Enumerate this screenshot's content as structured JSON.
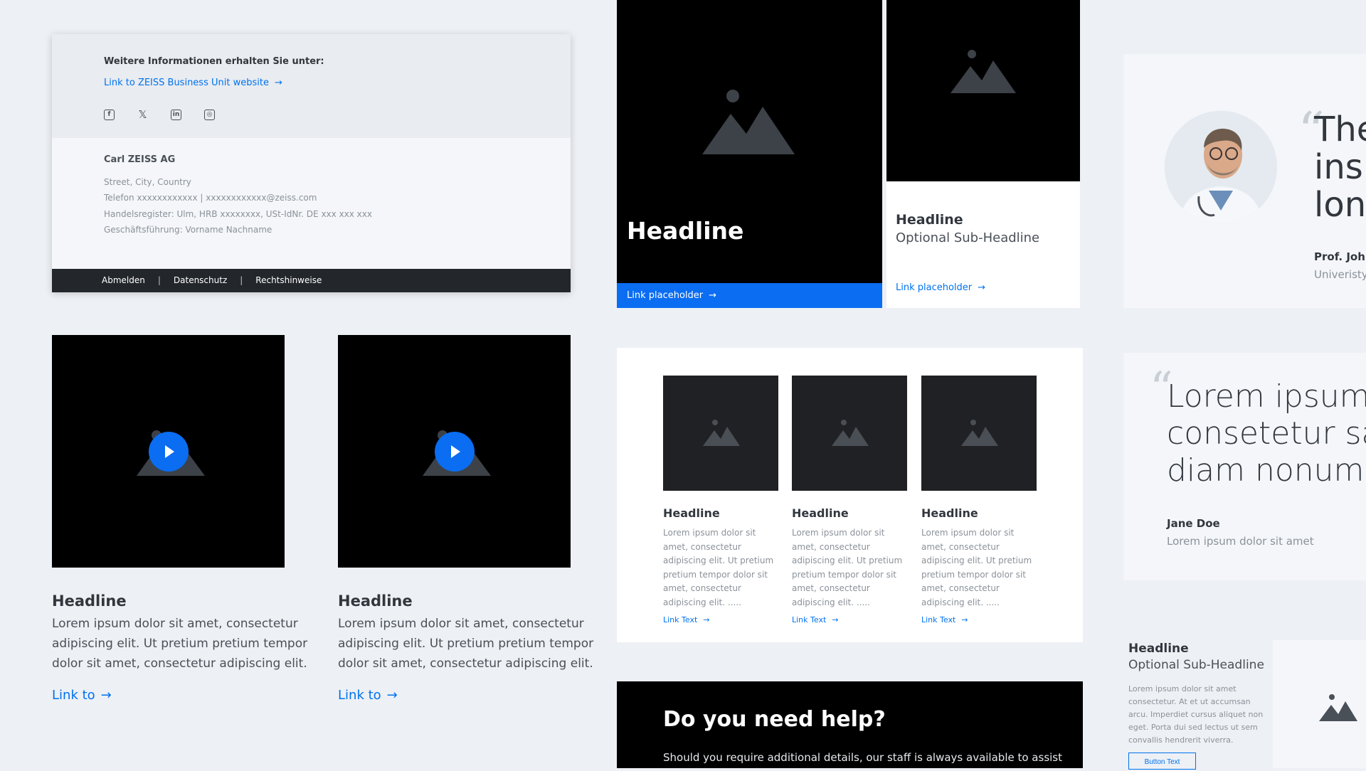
{
  "footer": {
    "info_label": "Weitere Informationen erhalten Sie unter:",
    "bu_link": "Link to ZEISS Business Unit website",
    "arrow": "→",
    "socials": [
      "facebook-icon",
      "x-icon",
      "linkedin-icon",
      "instagram-icon"
    ],
    "company": "Carl ZEISS AG",
    "address": "Street, City, Country",
    "contact": "Telefon xxxxxxxxxxxx |  xxxxxxxxxxxx@zeiss.com",
    "register": "Handelsregister: Ulm, HRB xxxxxxxx, USt-IdNr. DE xxx xxx xxx",
    "management": "Geschäftsführung: Vorname Nachname",
    "bar_links": [
      "Abmelden",
      "Datenschutz",
      "Rechtshinweise"
    ],
    "separator": "|"
  },
  "videos": [
    {
      "headline": "Headline",
      "text": "Lorem ipsum dolor sit amet, consectetur adipiscing elit. Ut pretium pretium tempor dolor sit amet, consectetur adipiscing elit.",
      "link": "Link to"
    },
    {
      "headline": "Headline",
      "text": "Lorem ipsum dolor sit amet, consectetur adipiscing elit. Ut pretium pretium tempor dolor sit amet, consectetur adipiscing elit.",
      "link": "Link to"
    }
  ],
  "hero": {
    "headline": "Headline",
    "link": "Link placeholder"
  },
  "card": {
    "headline": "Headline",
    "subheadline": "Optional Sub-Headline",
    "link": "Link placeholder"
  },
  "teasers": [
    {
      "headline": "Headline",
      "text": "Lorem ipsum dolor sit amet, consectetur adipiscing elit. Ut pretium pretium tempor dolor sit amet, consectetur adipiscing elit. .....",
      "link": "Link Text"
    },
    {
      "headline": "Headline",
      "text": "Lorem ipsum dolor sit amet, consectetur adipiscing elit. Ut pretium pretium tempor dolor sit amet, consectetur adipiscing elit. .....",
      "link": "Link Text"
    },
    {
      "headline": "Headline",
      "text": "Lorem ipsum dolor sit amet, consectetur adipiscing elit. Ut pretium pretium tempor dolor sit amet, consectetur adipiscing elit. .....",
      "link": "Link Text"
    }
  ],
  "help": {
    "headline": "Do you need help?",
    "text": "Should you require additional details, our staff is always available to assist"
  },
  "quote1": {
    "mark": "“",
    "lines": [
      "The",
      "insp",
      "long"
    ],
    "name": "Prof. John",
    "org": "Univeristy"
  },
  "quote2": {
    "mark": "“",
    "lines": [
      "Lorem ipsum",
      "consetetur sad",
      "diam nonumy"
    ],
    "name": "Jane Doe",
    "role": "Lorem ipsum dolor sit amet"
  },
  "side": {
    "headline": "Headline",
    "subheadline": "Optional Sub-Headline",
    "text": "Lorem ipsum dolor sit amet consectetur. At et ut accumsan arcu. Imperdiet cursus aliquet non eget. Porta dui sed lectus ut sem convallis hendrerit viverra.",
    "button": "Button Text"
  },
  "colors": {
    "accent": "#0a6df2",
    "link": "#0072ef",
    "dark": "#23262b",
    "placeholder": "#3d4148"
  }
}
